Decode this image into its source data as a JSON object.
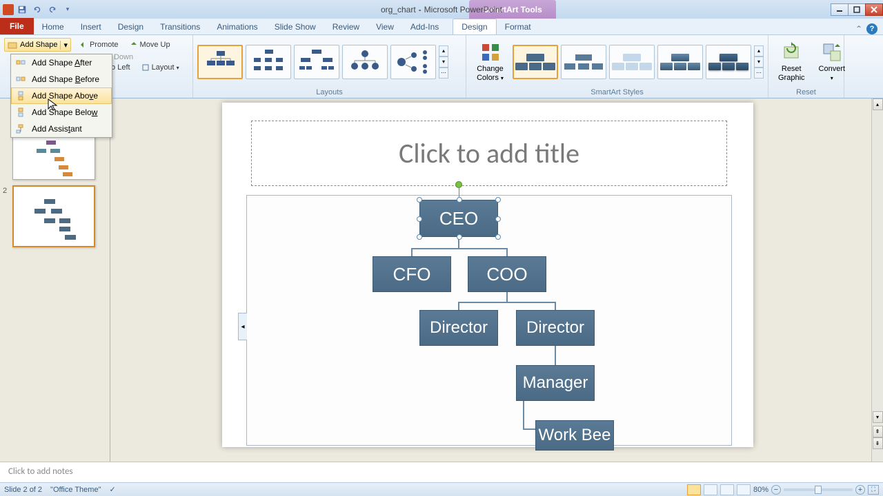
{
  "titlebar": {
    "filename": "org_chart",
    "app": "Microsoft PowerPoint",
    "context_tool": "SmartArt Tools"
  },
  "tabs": {
    "file": "File",
    "home": "Home",
    "insert": "Insert",
    "design": "Design",
    "transitions": "Transitions",
    "animations": "Animations",
    "slideshow": "Slide Show",
    "review": "Review",
    "view": "View",
    "addins": "Add-Ins",
    "sa_design": "Design",
    "sa_format": "Format"
  },
  "ribbon": {
    "add_shape": "Add Shape",
    "promote": "Promote",
    "move_up": "Move Up",
    "move_down": "Move Down",
    "to_left": "to Left",
    "layout": "Layout",
    "layouts_label": "Layouts",
    "change_colors": "Change Colors",
    "styles_label": "SmartArt Styles",
    "reset_graphic": "Reset Graphic",
    "convert": "Convert",
    "reset_label": "Reset"
  },
  "dropdown": {
    "after": "Add Shape After",
    "before": "Add Shape Before",
    "above": "Add Shape Above",
    "below": "Add Shape Below",
    "assistant": "Add Assistant"
  },
  "slide": {
    "title_placeholder": "Click to add title",
    "notes_placeholder": "Click to add notes"
  },
  "chart_data": {
    "type": "org_chart",
    "nodes": [
      {
        "id": "ceo",
        "label": "CEO",
        "children": [
          "cfo",
          "coo"
        ],
        "selected": true
      },
      {
        "id": "cfo",
        "label": "CFO",
        "children": []
      },
      {
        "id": "coo",
        "label": "COO",
        "children": [
          "dir1",
          "dir2"
        ]
      },
      {
        "id": "dir1",
        "label": "Director",
        "children": []
      },
      {
        "id": "dir2",
        "label": "Director",
        "children": [
          "mgr"
        ]
      },
      {
        "id": "mgr",
        "label": "Manager",
        "children": [
          "wb"
        ]
      },
      {
        "id": "wb",
        "label": "Work Bee",
        "children": []
      }
    ]
  },
  "status": {
    "slide": "Slide 2 of 2",
    "theme": "\"Office Theme\"",
    "zoom": "80%"
  },
  "thumbs": {
    "slide2_num": "2"
  },
  "colors": {
    "node_fill": "#4a6a85",
    "accent": "#e5a23a"
  }
}
